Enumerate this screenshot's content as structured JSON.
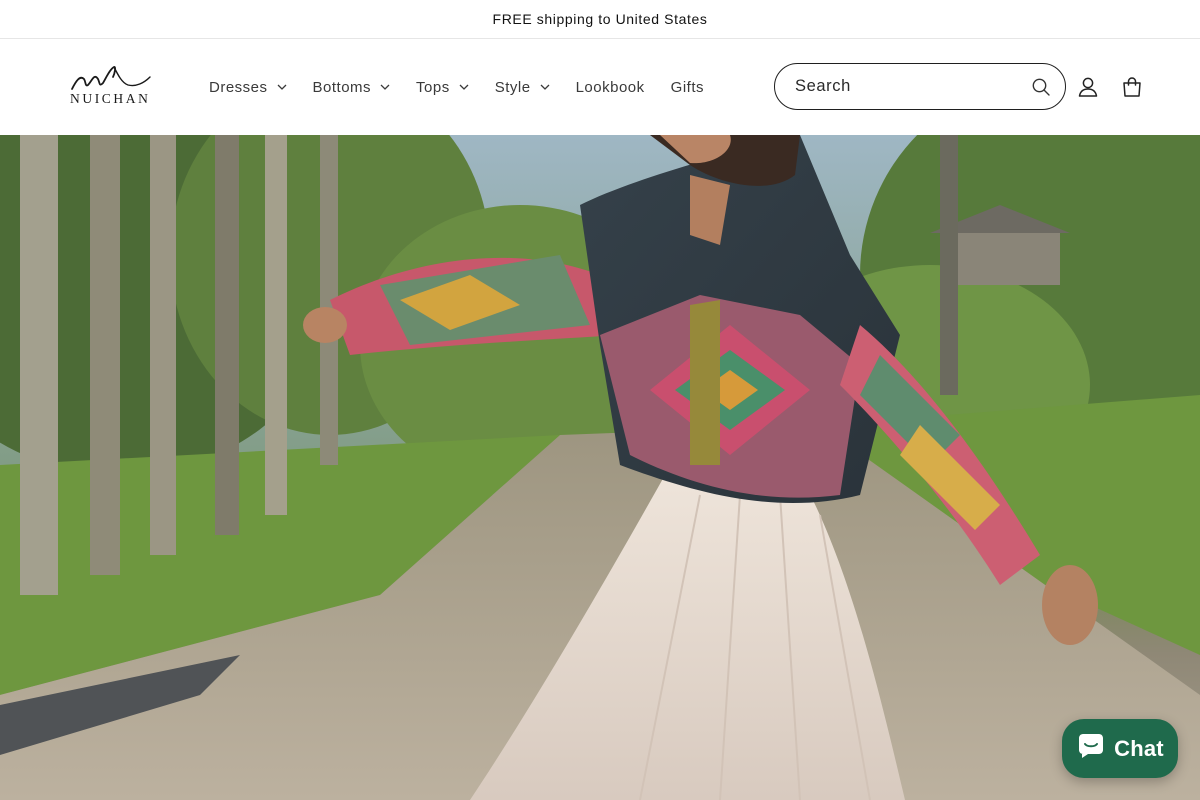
{
  "announcement": {
    "text": "FREE shipping to United States"
  },
  "brand": {
    "name": "NUICHAN"
  },
  "nav": {
    "items": [
      {
        "label": "Dresses",
        "has_dropdown": true
      },
      {
        "label": "Bottoms",
        "has_dropdown": true
      },
      {
        "label": "Tops",
        "has_dropdown": true
      },
      {
        "label": "Style",
        "has_dropdown": true
      },
      {
        "label": "Lookbook",
        "has_dropdown": false
      },
      {
        "label": "Gifts",
        "has_dropdown": false
      }
    ]
  },
  "search": {
    "placeholder": "Search",
    "value": ""
  },
  "icons": {
    "search": "search-icon",
    "account": "account-icon",
    "cart": "cart-icon",
    "dropdown": "chevron-down-icon",
    "chat": "chat-bubble-icon"
  },
  "chat": {
    "label": "Chat"
  },
  "colors": {
    "chat_button": "#1f6a4c",
    "text": "#121212"
  }
}
